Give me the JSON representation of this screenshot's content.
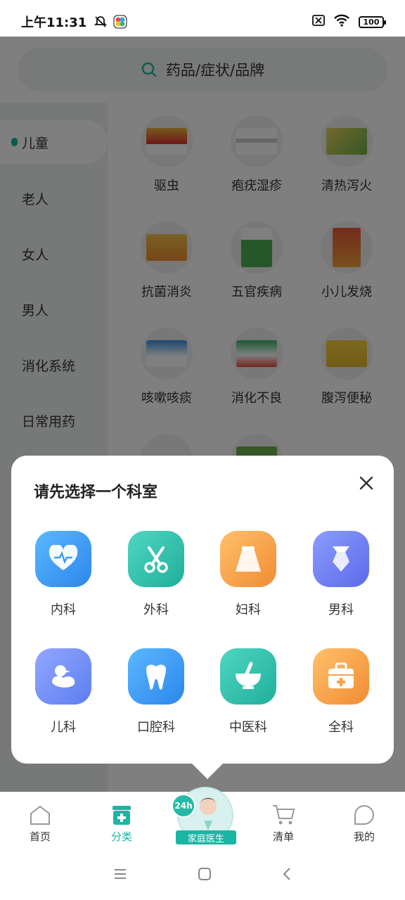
{
  "status_bar": {
    "time": "上午11:31",
    "battery": "100"
  },
  "search": {
    "placeholder": "药品/症状/品牌"
  },
  "categories": [
    {
      "label": "儿童",
      "active": true
    },
    {
      "label": "老人"
    },
    {
      "label": "女人"
    },
    {
      "label": "男人"
    },
    {
      "label": "消化系统"
    },
    {
      "label": "日常用药"
    }
  ],
  "subcategories": [
    {
      "label": "驱虫"
    },
    {
      "label": "疱疣湿疹"
    },
    {
      "label": "清热泻火"
    },
    {
      "label": "抗菌消炎"
    },
    {
      "label": "五官疾病"
    },
    {
      "label": "小儿发烧"
    },
    {
      "label": "咳嗽咳痰"
    },
    {
      "label": "消化不良"
    },
    {
      "label": "腹泻便秘"
    }
  ],
  "popup": {
    "title": "请先选择一个科室",
    "departments": [
      {
        "label": "内科",
        "icon": "heart-pulse-icon",
        "color": "#3d9df0"
      },
      {
        "label": "外科",
        "icon": "scissors-icon",
        "color": "#2ec3b0"
      },
      {
        "label": "妇科",
        "icon": "skirt-icon",
        "color": "#f5a34a"
      },
      {
        "label": "男科",
        "icon": "tie-icon",
        "color": "#6f7ff0"
      },
      {
        "label": "儿科",
        "icon": "duck-icon",
        "color": "#6b8bf5"
      },
      {
        "label": "口腔科",
        "icon": "tooth-icon",
        "color": "#3d9df0"
      },
      {
        "label": "中医科",
        "icon": "mortar-icon",
        "color": "#2ec3b0"
      },
      {
        "label": "全科",
        "icon": "medical-kit-icon",
        "color": "#f5a34a"
      }
    ]
  },
  "tabbar": {
    "home": "首页",
    "category": "分类",
    "doctor_badge": "24h",
    "doctor": "家庭医生",
    "cart": "清单",
    "mine": "我的"
  }
}
